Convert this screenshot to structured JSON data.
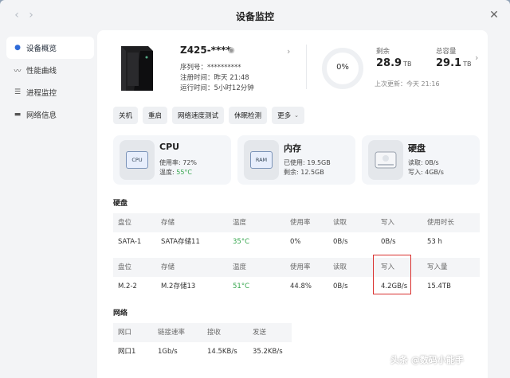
{
  "window": {
    "title": "设备监控"
  },
  "sidebar": {
    "items": [
      {
        "label": "设备概览",
        "icon": "overview-icon",
        "active": true
      },
      {
        "label": "性能曲线",
        "icon": "chart-icon",
        "active": false
      },
      {
        "label": "进程监控",
        "icon": "process-icon",
        "active": false
      },
      {
        "label": "网络信息",
        "icon": "network-icon",
        "active": false
      }
    ]
  },
  "device": {
    "name": "Z425-****",
    "serial": "序列号：**********",
    "registered": "注册时间：昨天 21:48",
    "uptime": "运行时间：5小时12分钟"
  },
  "storage_summary": {
    "percent": "0%",
    "remaining_label": "剩余",
    "remaining_value": "28.9",
    "remaining_unit": "TB",
    "total_label": "总容量",
    "total_value": "29.1",
    "total_unit": "TB",
    "last_update": "上次更新：今天 21:16"
  },
  "actions": {
    "shutdown": "关机",
    "restart": "重启",
    "speedtest": "网络速度测试",
    "sleep": "休眠检测",
    "more": "更多"
  },
  "cards": {
    "cpu": {
      "title": "CPU",
      "chip": "CPU",
      "usage": "使用率: 72%",
      "temp_label": "温度: ",
      "temp_value": "55°C"
    },
    "memory": {
      "title": "内存",
      "chip": "RAM",
      "used": "已使用: 19.5GB",
      "free": "剩余: 12.5GB"
    },
    "disk": {
      "title": "硬盘",
      "read": "读取: 0B/s",
      "write": "写入: 4GB/s"
    }
  },
  "disk_section": {
    "title": "硬盘",
    "table1": {
      "headers": [
        "盘位",
        "存储",
        "温度",
        "使用率",
        "读取",
        "写入",
        "使用时长"
      ],
      "row": [
        "SATA-1",
        "SATA存储11",
        "35°C",
        "0%",
        "0B/s",
        "0B/s",
        "53 h"
      ]
    },
    "table2": {
      "headers": [
        "盘位",
        "存储",
        "温度",
        "使用率",
        "读取",
        "写入",
        "写入量"
      ],
      "row": [
        "M.2-2",
        "M.2存储13",
        "51°C",
        "44.8%",
        "0B/s",
        "4.2GB/s",
        "15.4TB"
      ]
    }
  },
  "network_section": {
    "title": "网络",
    "headers": [
      "网口",
      "链接速率",
      "接收",
      "发送"
    ],
    "row": [
      "网口1",
      "1Gb/s",
      "14.5KB/s",
      "35.2KB/s"
    ]
  },
  "watermark": "头条 @数码小能手",
  "colors": {
    "accent": "#2f6bd8",
    "temp_green": "#35a64d",
    "highlight_red": "#d9302e"
  }
}
